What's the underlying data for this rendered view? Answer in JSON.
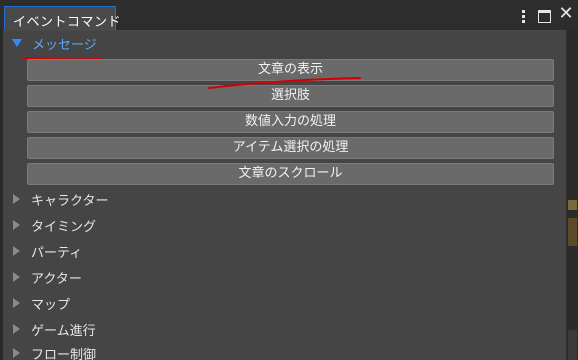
{
  "window": {
    "tab_title": "イベントコマンド",
    "controls": {
      "menu_icon": "kebab-icon",
      "maximize_icon": "maximize-icon",
      "close_icon": "close-icon",
      "close_glyph": "✕"
    }
  },
  "group": {
    "label": "メッセージ",
    "expanded": true,
    "commands": [
      {
        "label": "文章の表示"
      },
      {
        "label": "選択肢"
      },
      {
        "label": "数値入力の処理"
      },
      {
        "label": "アイテム選択の処理"
      },
      {
        "label": "文章のスクロール"
      }
    ]
  },
  "tree": {
    "collapsed_items": [
      {
        "label": "キャラクター"
      },
      {
        "label": "タイミング"
      },
      {
        "label": "パーティ"
      },
      {
        "label": "アクター"
      },
      {
        "label": "マップ"
      },
      {
        "label": "ゲーム進行"
      },
      {
        "label": "フロー制御"
      }
    ]
  },
  "colors": {
    "accent_blue": "#2f8cff",
    "annotation_red": "#d40000",
    "panel_bg": "#454545",
    "button_bg": "#6a6a6a"
  }
}
